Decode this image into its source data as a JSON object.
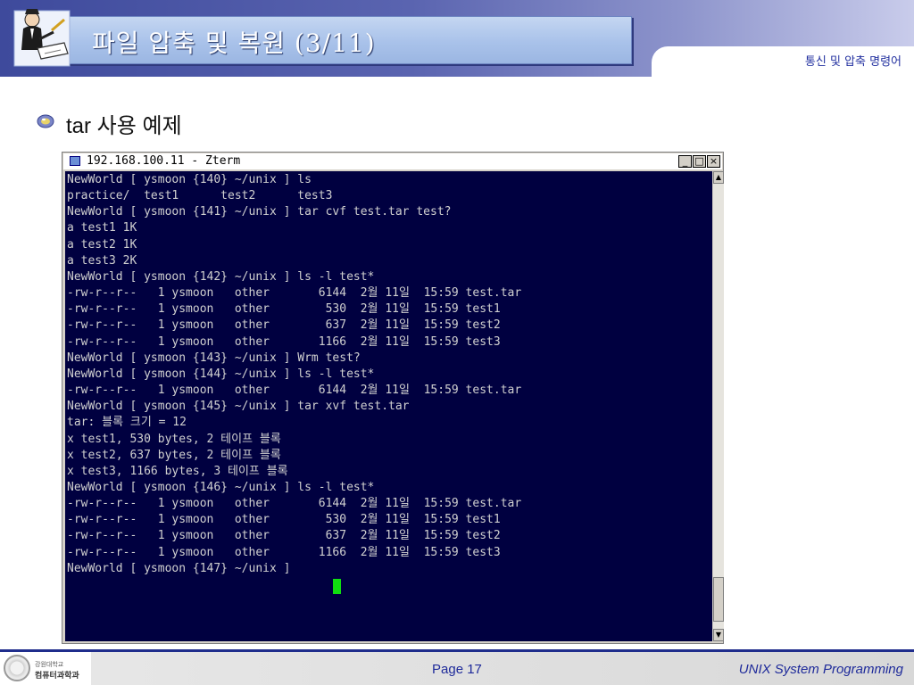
{
  "header": {
    "title": "파일 압축 및 복원 (3/11)",
    "subtitle": "통신 및 압축 명령어",
    "logo_icon": "writer-at-desk-icon"
  },
  "bullet": {
    "icon": "round-bullet-icon",
    "text": "tar 사용 예제"
  },
  "terminal_window": {
    "title": "192.168.100.11 - Zterm",
    "buttons": {
      "minimize": "_",
      "maximize": "□",
      "close": "×"
    },
    "lines": [
      "NewWorld [ ysmoon {140} ~/unix ] ls",
      "practice/  test1      test2      test3",
      "NewWorld [ ysmoon {141} ~/unix ] tar cvf test.tar test?",
      "a test1 1K",
      "a test2 1K",
      "a test3 2K",
      "NewWorld [ ysmoon {142} ~/unix ] ls -l test*",
      "-rw-r--r--   1 ysmoon   other       6144  2월 11일  15:59 test.tar",
      "-rw-r--r--   1 ysmoon   other        530  2월 11일  15:59 test1",
      "-rw-r--r--   1 ysmoon   other        637  2월 11일  15:59 test2",
      "-rw-r--r--   1 ysmoon   other       1166  2월 11일  15:59 test3",
      "NewWorld [ ysmoon {143} ~/unix ] Wrm test?",
      "NewWorld [ ysmoon {144} ~/unix ] ls -l test*",
      "-rw-r--r--   1 ysmoon   other       6144  2월 11일  15:59 test.tar",
      "NewWorld [ ysmoon {145} ~/unix ] tar xvf test.tar",
      "tar: 블록 크기 = 12",
      "x test1, 530 bytes, 2 테이프 블록",
      "x test2, 637 bytes, 2 테이프 블록",
      "x test3, 1166 bytes, 3 테이프 블록",
      "NewWorld [ ysmoon {146} ~/unix ] ls -l test*",
      "-rw-r--r--   1 ysmoon   other       6144  2월 11일  15:59 test.tar",
      "-rw-r--r--   1 ysmoon   other        530  2월 11일  15:59 test1",
      "-rw-r--r--   1 ysmoon   other        637  2월 11일  15:59 test2",
      "-rw-r--r--   1 ysmoon   other       1166  2월 11일  15:59 test3",
      "NewWorld [ ysmoon {147} ~/unix ] "
    ],
    "colors": {
      "background": "#000040",
      "text": "#d0d0d0",
      "cursor": "#10e010"
    }
  },
  "footer": {
    "logo_text_small": "강원대학교",
    "logo_text_big": "컴퓨터과학과",
    "page": "Page 17",
    "course": "UNIX System Programming"
  }
}
